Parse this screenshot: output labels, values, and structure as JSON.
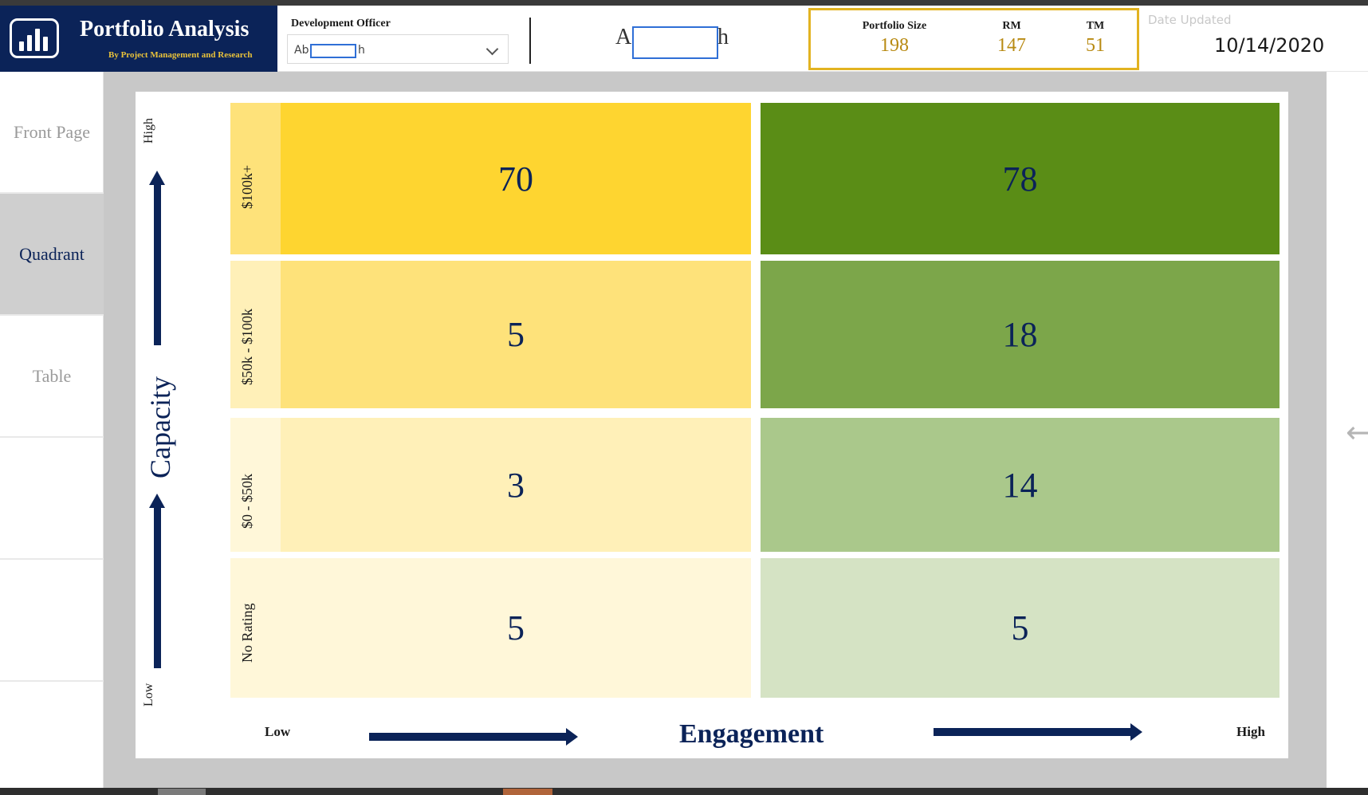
{
  "app": {
    "title": "Portfolio Analysis",
    "subtitle": "By Project Management and Research"
  },
  "filters": {
    "officer_label": "Development Officer",
    "officer_value_prefix": "Ab",
    "officer_value_suffix": "h",
    "selected_officer_prefix": "A",
    "selected_officer_suffix": "h"
  },
  "kpis": [
    {
      "label": "Portfolio Size",
      "value": "198"
    },
    {
      "label": "RM",
      "value": "147"
    },
    {
      "label": "TM",
      "value": "51"
    }
  ],
  "date": {
    "label": "Date Updated",
    "value": "10/14/2020"
  },
  "nav": [
    {
      "label": "Front Page",
      "active": false
    },
    {
      "label": "Quadrant",
      "active": true
    },
    {
      "label": "Table",
      "active": false
    },
    {
      "label": "",
      "active": false
    },
    {
      "label": "",
      "active": false
    },
    {
      "label": "",
      "active": false
    }
  ],
  "quadrant": {
    "y_title": "Capacity",
    "y_high": "High",
    "y_low": "Low",
    "x_title": "Engagement",
    "x_low": "Low",
    "x_high": "High",
    "rows": [
      {
        "label": "$100k+",
        "low": "70",
        "high": "78"
      },
      {
        "label": "$50k - $100k",
        "low": "5",
        "high": "18"
      },
      {
        "label": "$0 - $50k",
        "low": "3",
        "high": "14"
      },
      {
        "label": "No Rating",
        "low": "5",
        "high": "5"
      }
    ]
  },
  "colors": {
    "brand_navy": "#0b2358",
    "kpi_gold": "#e2b321",
    "low_engagement": [
      "#fed530",
      "#fee27a",
      "#fff0b8",
      "#fff7d9"
    ],
    "high_engagement": [
      "#5a8d16",
      "#7ca64a",
      "#aac88b",
      "#d5e3c4"
    ]
  },
  "icons": {
    "logo": "bar-chart-icon",
    "dropdown": "chevron-down-icon",
    "back": "arrow-left-icon"
  }
}
